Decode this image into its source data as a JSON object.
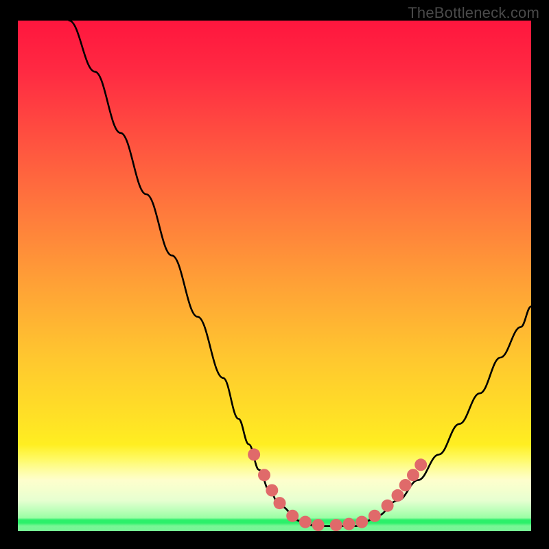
{
  "watermark": "TheBottleneck.com",
  "chart_data": {
    "type": "line",
    "title": "",
    "xlabel": "",
    "ylabel": "",
    "xlim": [
      0,
      100
    ],
    "ylim": [
      0,
      100
    ],
    "grid": false,
    "legend": false,
    "series": [
      {
        "name": "bottleneck-curve",
        "color": "#000000",
        "x": [
          10,
          15,
          20,
          25,
          30,
          35,
          40,
          43,
          45,
          47,
          49,
          51,
          55,
          58,
          61,
          63,
          66,
          68,
          70,
          74,
          78,
          82,
          86,
          90,
          94,
          98,
          100
        ],
        "y": [
          100,
          90,
          78,
          66,
          54,
          42,
          30,
          22,
          17,
          12,
          8,
          5,
          2,
          1,
          1,
          1,
          1,
          2,
          3,
          6,
          10,
          15,
          21,
          27,
          34,
          40,
          44
        ]
      }
    ],
    "markers": [
      {
        "name": "optimal-dots",
        "color": "#e06a6a",
        "radius": 9,
        "points": [
          {
            "x": 46,
            "y": 15
          },
          {
            "x": 48,
            "y": 11
          },
          {
            "x": 49.5,
            "y": 8
          },
          {
            "x": 51,
            "y": 5.5
          },
          {
            "x": 53.5,
            "y": 3
          },
          {
            "x": 56,
            "y": 1.8
          },
          {
            "x": 58.5,
            "y": 1.2
          },
          {
            "x": 62,
            "y": 1.2
          },
          {
            "x": 64.5,
            "y": 1.4
          },
          {
            "x": 67,
            "y": 1.8
          },
          {
            "x": 69.5,
            "y": 3
          },
          {
            "x": 72,
            "y": 5
          },
          {
            "x": 74,
            "y": 7
          },
          {
            "x": 75.5,
            "y": 9
          },
          {
            "x": 77,
            "y": 11
          },
          {
            "x": 78.5,
            "y": 13
          }
        ]
      }
    ],
    "background_gradient": {
      "stops": [
        {
          "pos": 0,
          "color": "#ff163e"
        },
        {
          "pos": 50,
          "color": "#ffb030"
        },
        {
          "pos": 85,
          "color": "#fff61e"
        },
        {
          "pos": 95,
          "color": "#d7ffa8"
        },
        {
          "pos": 100,
          "color": "#2cf06a"
        }
      ]
    }
  }
}
